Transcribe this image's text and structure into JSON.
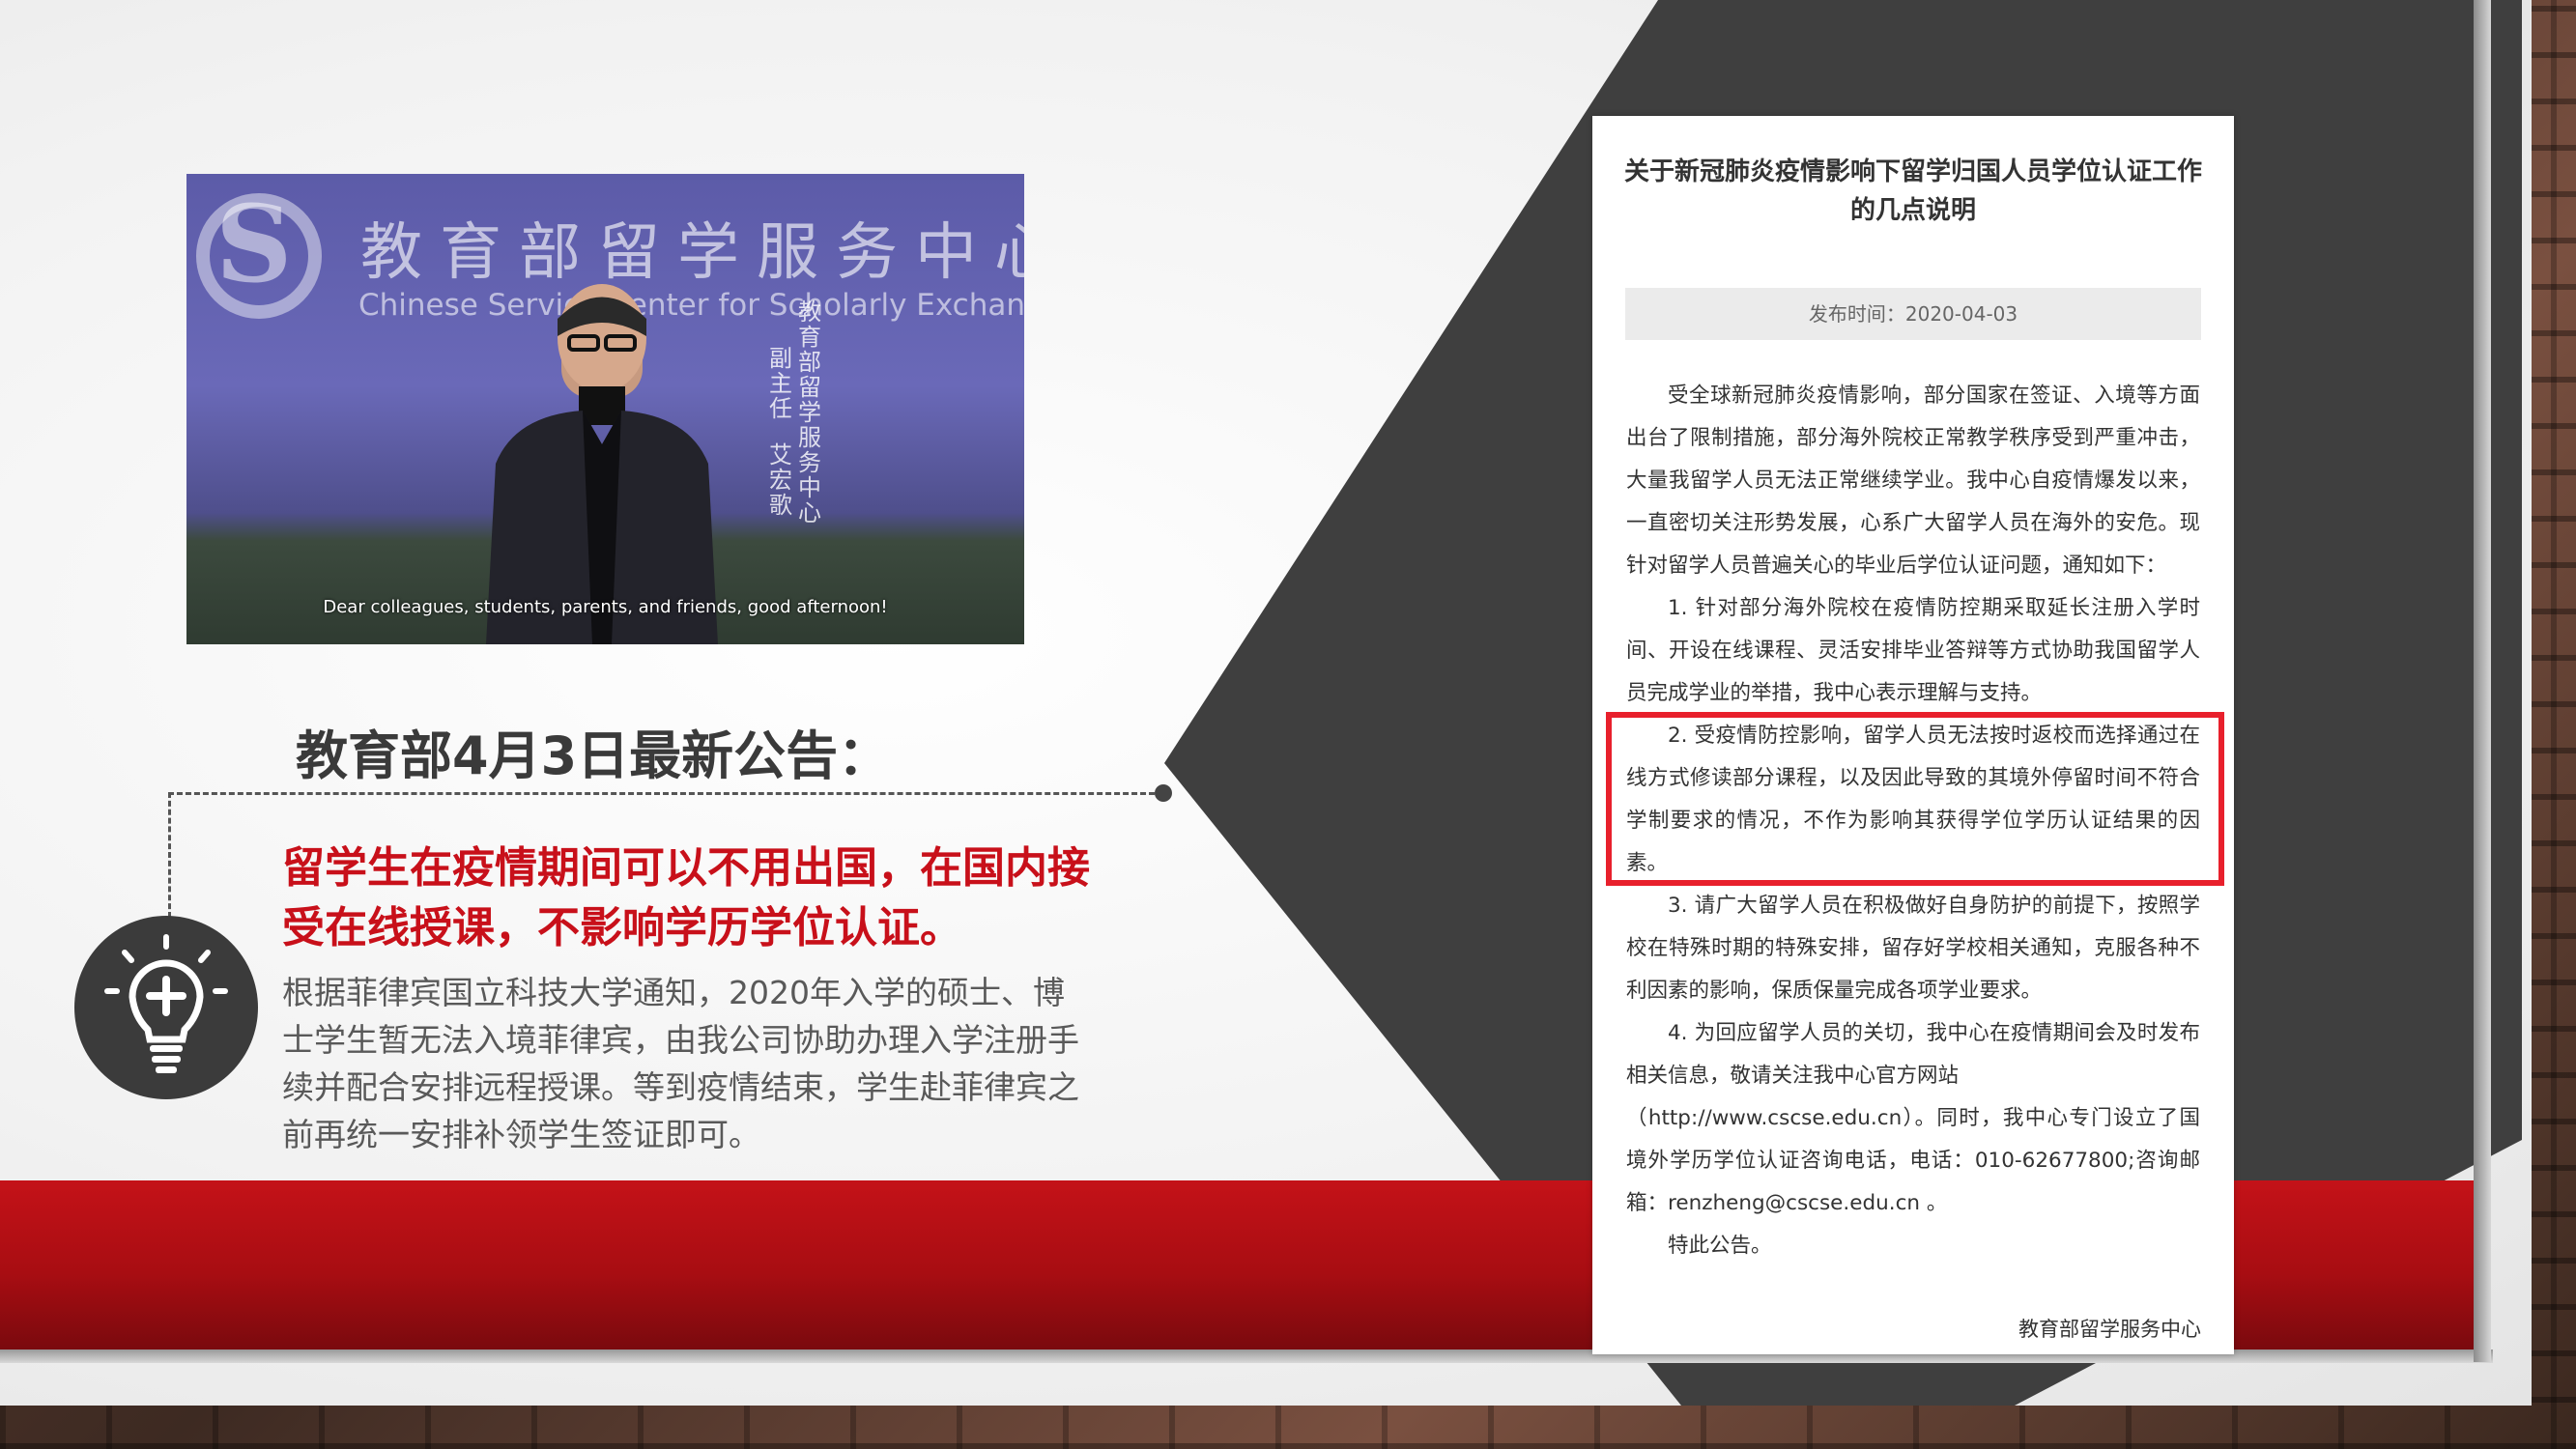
{
  "video": {
    "org_cn": "教育部留学服务中心",
    "org_en": "Chinese Service Center for Scholarly Exchange",
    "caption_col1": "教育部留学服务中心",
    "caption_col2": "副主任",
    "caption_col3": "艾宏歌",
    "subtitle": "Dear colleagues, students, parents, and friends, good afternoon!"
  },
  "headline": "教育部4月3日最新公告：",
  "highlight_text": "留学生在疫情期间可以不用出国，在国内接受在线授课，不影响学历学位认证。",
  "body_text": "根据菲律宾国立科技大学通知，2020年入学的硕士、博士学生暂无法入境菲律宾，由我公司协助办理入学注册手续并配合安排远程授课。等到疫情结束，学生赴菲律宾之前再统一安排补领学生签证即可。",
  "icon": "lightbulb-plus-icon",
  "colors": {
    "accent_red": "#c8101a",
    "dark_gray": "#3b3b3b",
    "highlight_box": "#e8202c"
  },
  "document": {
    "title": "关于新冠肺炎疫情影响下留学归国人员学位认证工作的几点说明",
    "date_line": "发布时间：2020-04-03",
    "paragraphs": [
      "受全球新冠肺炎疫情影响，部分国家在签证、入境等方面出台了限制措施，部分海外院校正常教学秩序受到严重冲击，大量我留学人员无法正常继续学业。我中心自疫情爆发以来，一直密切关注形势发展，心系广大留学人员在海外的安危。现针对留学人员普遍关心的毕业后学位认证问题，通知如下：",
      "1. 针对部分海外院校在疫情防控期采取延长注册入学时间、开设在线课程、灵活安排毕业答辩等方式协助我国留学人员完成学业的举措，我中心表示理解与支持。",
      "2. 受疫情防控影响，留学人员无法按时返校而选择通过在线方式修读部分课程，以及因此导致的其境外停留时间不符合学制要求的情况，不作为影响其获得学位学历认证结果的因素。",
      "3. 请广大留学人员在积极做好自身防护的前提下，按照学校在特殊时期的特殊安排，留存好学校相关通知，克服各种不利因素的影响，保质保量完成各项学业要求。",
      "4. 为回应留学人员的关切，我中心在疫情期间会及时发布相关信息，敬请关注我中心官方网站",
      "（http://www.cscse.edu.cn）。同时，我中心专门设立了国境外学历学位认证咨询电话，电话：010-62677800;咨询邮箱：renzheng@cscse.edu.cn 。",
      "特此公告。"
    ],
    "signature": "教育部留学服务中心"
  }
}
